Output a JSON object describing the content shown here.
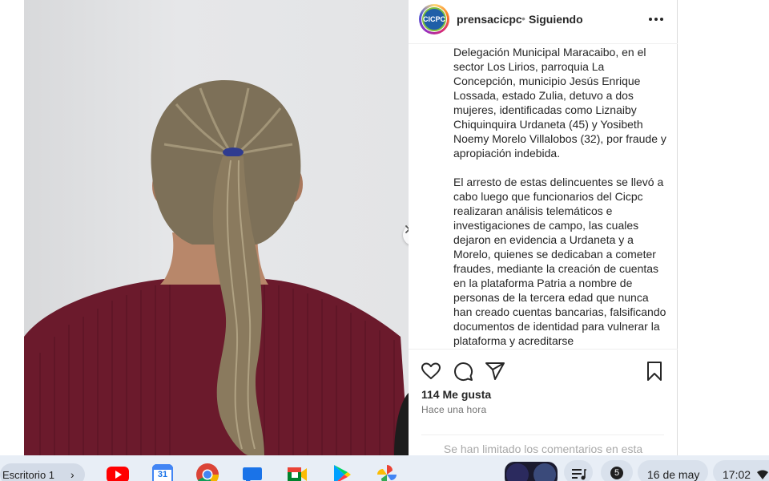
{
  "post": {
    "username": "prensacicpc",
    "separator": "•",
    "follow_status": "Siguiendo",
    "avatar_text": "CICPC",
    "caption": [
      "Delegación Municipal Maracaibo, en el sector Los Lirios, parroquia La Concepción, municipio Jesús Enrique Lossada, estado Zulia, detuvo a dos mujeres, identificadas como Liznaiby Chiquinquira Urdaneta (45) y Yosibeth Noemy Morelo Villalobos (32), por fraude y apropiación indebida.",
      "El arresto de estas delincuentes se llevó a cabo luego que funcionarios del Cicpc realizaran análisis telemáticos e investigaciones de campo, las cuales dejaron en evidencia a Urdaneta y a Morelo, quienes se dedicaban a cometer fraudes, mediante la creación de cuentas en la plataforma Patria a nombre de personas de la tercera edad que nunca han creado cuentas bancarias, falsificando documentos de identidad para vulnerar la plataforma y acreditarse"
    ],
    "likes": "114 Me gusta",
    "posted": "Hace una hora",
    "comments_limited": "Se han limitado los comentarios en esta"
  },
  "shelf": {
    "desk_label": "Escritorio 1",
    "calendar_day": "31",
    "notification_count": "5",
    "date": "16 de may",
    "time": "17:02"
  },
  "colors": {
    "shirt": "#6b1a2c",
    "hair": "#8a7a5e",
    "shelf_bg": "#e8eef6"
  }
}
